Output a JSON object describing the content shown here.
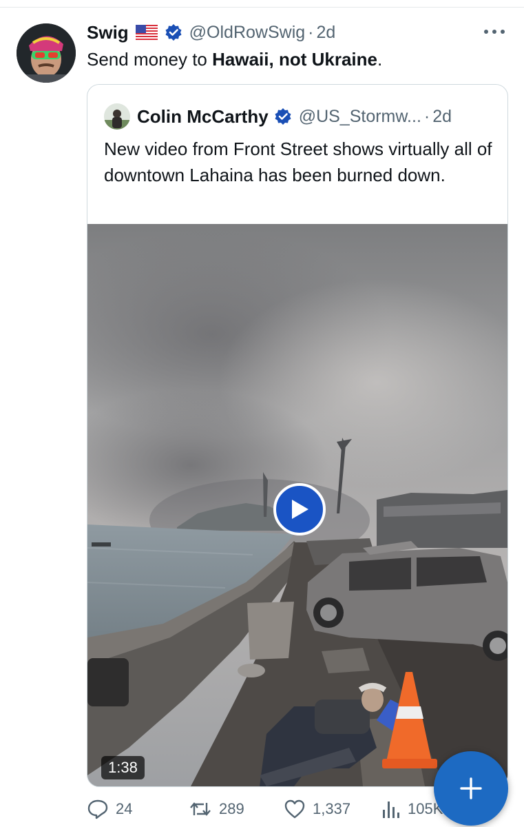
{
  "tweet": {
    "author_name": "Swig",
    "author_flag": "us-flag-emoji",
    "handle": "@OldRowSwig",
    "separator": "·",
    "time": "2d",
    "text_prefix": "Send money to ",
    "text_bold": "Hawaii, not Ukraine",
    "text_suffix": ".",
    "more_icon": "more-options-icon"
  },
  "quote": {
    "author_name": "Colin McCarthy",
    "handle": "@US_Stormw...",
    "separator": "·",
    "time": "2d",
    "text": "New video from Front Street shows virtually all of downtown Lahaina has been burned down.",
    "video": {
      "duration": "1:38",
      "play_icon": "play-icon"
    }
  },
  "actions": {
    "replies": "24",
    "reposts": "289",
    "likes": "1,337",
    "views": "105K"
  },
  "fab": {
    "icon": "plus-icon"
  },
  "colors": {
    "accent": "#1d9bf0",
    "verified": "#1a4fb5",
    "fab": "#1d6ac2",
    "secondary_text": "#536471"
  }
}
